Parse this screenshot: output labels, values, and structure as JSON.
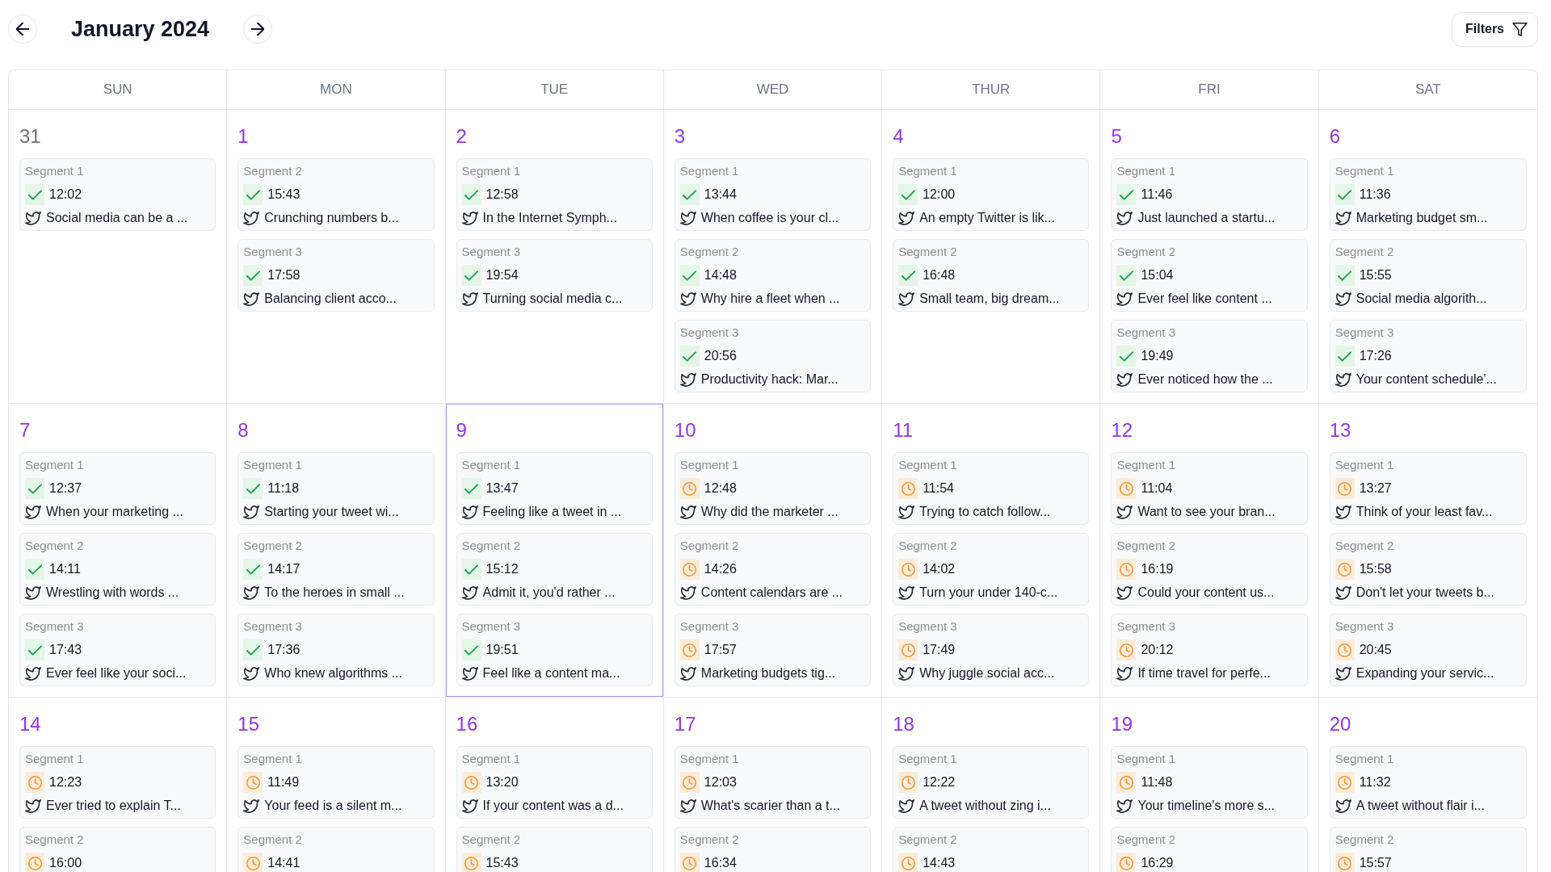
{
  "header": {
    "title": "January 2024",
    "filters_label": "Filters"
  },
  "calendar": {
    "weekdays": [
      "SUN",
      "MON",
      "TUE",
      "WED",
      "THUR",
      "FRI",
      "SAT"
    ],
    "weeks": [
      {
        "days": [
          {
            "number": "31",
            "outside_month": true,
            "selected": false,
            "posts": [
              {
                "segment": "Segment 1",
                "published": true,
                "time": "12:02",
                "text": "Social media can be a ..."
              }
            ]
          },
          {
            "number": "1",
            "outside_month": false,
            "selected": false,
            "posts": [
              {
                "segment": "Segment 2",
                "published": true,
                "time": "15:43",
                "text": "Crunching numbers b..."
              },
              {
                "segment": "Segment 3",
                "published": true,
                "time": "17:58",
                "text": "Balancing client acco..."
              }
            ]
          },
          {
            "number": "2",
            "outside_month": false,
            "selected": false,
            "posts": [
              {
                "segment": "Segment 1",
                "published": true,
                "time": "12:58",
                "text": "In the Internet Symph..."
              },
              {
                "segment": "Segment 3",
                "published": true,
                "time": "19:54",
                "text": "Turning social media c..."
              }
            ]
          },
          {
            "number": "3",
            "outside_month": false,
            "selected": false,
            "posts": [
              {
                "segment": "Segment 1",
                "published": true,
                "time": "13:44",
                "text": "When coffee is your cl..."
              },
              {
                "segment": "Segment 2",
                "published": true,
                "time": "14:48",
                "text": "Why hire a fleet when ..."
              },
              {
                "segment": "Segment 3",
                "published": true,
                "time": "20:56",
                "text": "Productivity hack: Mar..."
              }
            ]
          },
          {
            "number": "4",
            "outside_month": false,
            "selected": false,
            "posts": [
              {
                "segment": "Segment 1",
                "published": true,
                "time": "12:00",
                "text": "An empty Twitter is lik..."
              },
              {
                "segment": "Segment 2",
                "published": true,
                "time": "16:48",
                "text": "Small team, big dream..."
              }
            ]
          },
          {
            "number": "5",
            "outside_month": false,
            "selected": false,
            "posts": [
              {
                "segment": "Segment 1",
                "published": true,
                "time": "11:46",
                "text": "Just launched a startu..."
              },
              {
                "segment": "Segment 2",
                "published": true,
                "time": "15:04",
                "text": "Ever feel like content ..."
              },
              {
                "segment": "Segment 3",
                "published": true,
                "time": "19:49",
                "text": "Ever noticed how the ..."
              }
            ]
          },
          {
            "number": "6",
            "outside_month": false,
            "selected": false,
            "posts": [
              {
                "segment": "Segment 1",
                "published": true,
                "time": "11:36",
                "text": "Marketing budget sm..."
              },
              {
                "segment": "Segment 2",
                "published": true,
                "time": "15:55",
                "text": "Social media algorith..."
              },
              {
                "segment": "Segment 3",
                "published": true,
                "time": "17:26",
                "text": "Your content schedule'..."
              }
            ]
          }
        ]
      },
      {
        "days": [
          {
            "number": "7",
            "outside_month": false,
            "selected": false,
            "posts": [
              {
                "segment": "Segment 1",
                "published": true,
                "time": "12:37",
                "text": "When your marketing ..."
              },
              {
                "segment": "Segment 2",
                "published": true,
                "time": "14:11",
                "text": "Wrestling with words ..."
              },
              {
                "segment": "Segment 3",
                "published": true,
                "time": "17:43",
                "text": "Ever feel like your soci..."
              }
            ]
          },
          {
            "number": "8",
            "outside_month": false,
            "selected": false,
            "posts": [
              {
                "segment": "Segment 1",
                "published": true,
                "time": "11:18",
                "text": "Starting your tweet wi..."
              },
              {
                "segment": "Segment 2",
                "published": true,
                "time": "14:17",
                "text": "To the heroes in small ..."
              },
              {
                "segment": "Segment 3",
                "published": true,
                "time": "17:36",
                "text": "Who knew algorithms ..."
              }
            ]
          },
          {
            "number": "9",
            "outside_month": false,
            "selected": true,
            "posts": [
              {
                "segment": "Segment 1",
                "published": true,
                "time": "13:47",
                "text": "Feeling like a tweet in ..."
              },
              {
                "segment": "Segment 2",
                "published": true,
                "time": "15:12",
                "text": "Admit it, you'd rather ..."
              },
              {
                "segment": "Segment 3",
                "published": true,
                "time": "19:51",
                "text": "Feel like a content ma..."
              }
            ]
          },
          {
            "number": "10",
            "outside_month": false,
            "selected": false,
            "posts": [
              {
                "segment": "Segment 1",
                "published": false,
                "time": "12:48",
                "text": "Why did the marketer ..."
              },
              {
                "segment": "Segment 2",
                "published": false,
                "time": "14:26",
                "text": "Content calendars are ..."
              },
              {
                "segment": "Segment 3",
                "published": false,
                "time": "17:57",
                "text": "Marketing budgets tig..."
              }
            ]
          },
          {
            "number": "11",
            "outside_month": false,
            "selected": false,
            "posts": [
              {
                "segment": "Segment 1",
                "published": false,
                "time": "11:54",
                "text": "Trying to catch follow..."
              },
              {
                "segment": "Segment 2",
                "published": false,
                "time": "14:02",
                "text": "Turn your under 140-c..."
              },
              {
                "segment": "Segment 3",
                "published": false,
                "time": "17:49",
                "text": "Why juggle social acc..."
              }
            ]
          },
          {
            "number": "12",
            "outside_month": false,
            "selected": false,
            "posts": [
              {
                "segment": "Segment 1",
                "published": false,
                "time": "11:04",
                "text": "Want to see your bran..."
              },
              {
                "segment": "Segment 2",
                "published": false,
                "time": "16:19",
                "text": "Could your content us..."
              },
              {
                "segment": "Segment 3",
                "published": false,
                "time": "20:12",
                "text": "If time travel for perfe..."
              }
            ]
          },
          {
            "number": "13",
            "outside_month": false,
            "selected": false,
            "posts": [
              {
                "segment": "Segment 1",
                "published": false,
                "time": "13:27",
                "text": "Think of your least fav..."
              },
              {
                "segment": "Segment 2",
                "published": false,
                "time": "15:58",
                "text": "Don't let your tweets b..."
              },
              {
                "segment": "Segment 3",
                "published": false,
                "time": "20:45",
                "text": "Expanding your servic..."
              }
            ]
          }
        ]
      },
      {
        "days": [
          {
            "number": "14",
            "outside_month": false,
            "selected": false,
            "posts": [
              {
                "segment": "Segment 1",
                "published": false,
                "time": "12:23",
                "text": "Ever tried to explain T..."
              },
              {
                "segment": "Segment 2",
                "published": false,
                "time": "16:00"
              }
            ]
          },
          {
            "number": "15",
            "outside_month": false,
            "selected": false,
            "posts": [
              {
                "segment": "Segment 1",
                "published": false,
                "time": "11:49",
                "text": "Your feed is a silent m..."
              },
              {
                "segment": "Segment 2",
                "published": false,
                "time": "14:41"
              }
            ]
          },
          {
            "number": "16",
            "outside_month": false,
            "selected": false,
            "posts": [
              {
                "segment": "Segment 1",
                "published": false,
                "time": "13:20",
                "text": "If your content was a d..."
              },
              {
                "segment": "Segment 2",
                "published": false,
                "time": "15:43"
              }
            ]
          },
          {
            "number": "17",
            "outside_month": false,
            "selected": false,
            "posts": [
              {
                "segment": "Segment 1",
                "published": false,
                "time": "12:03",
                "text": "What's scarier than a t..."
              },
              {
                "segment": "Segment 2",
                "published": false,
                "time": "16:34"
              }
            ]
          },
          {
            "number": "18",
            "outside_month": false,
            "selected": false,
            "posts": [
              {
                "segment": "Segment 1",
                "published": false,
                "time": "12:22",
                "text": "A tweet without zing i..."
              },
              {
                "segment": "Segment 2",
                "published": false,
                "time": "14:43"
              }
            ]
          },
          {
            "number": "19",
            "outside_month": false,
            "selected": false,
            "posts": [
              {
                "segment": "Segment 1",
                "published": false,
                "time": "11:48",
                "text": "Your timeline's more s..."
              },
              {
                "segment": "Segment 2",
                "published": false,
                "time": "16:29"
              }
            ]
          },
          {
            "number": "20",
            "outside_month": false,
            "selected": false,
            "posts": [
              {
                "segment": "Segment 1",
                "published": false,
                "time": "11:32",
                "text": "A tweet without flair i..."
              },
              {
                "segment": "Segment 2",
                "published": false,
                "time": "15:57"
              }
            ]
          }
        ]
      }
    ]
  }
}
